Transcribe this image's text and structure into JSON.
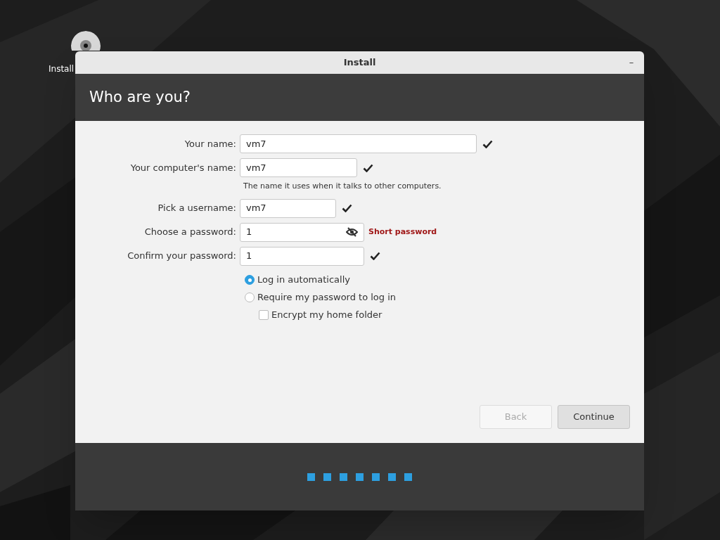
{
  "desktop": {
    "icons": [
      {
        "label": "Install"
      }
    ]
  },
  "window": {
    "title": "Install",
    "minimize": "–"
  },
  "header": {
    "title": "Who are you?"
  },
  "form": {
    "fields": [
      {
        "label": "Your name:",
        "value": "vm7",
        "kind": "text",
        "valid": true
      },
      {
        "label": "Your computer's name:",
        "value": "vm7",
        "kind": "text",
        "valid": true,
        "hint": "The name it uses when it talks to other computers."
      },
      {
        "label": "Pick a username:",
        "value": "vm7",
        "kind": "text",
        "valid": true
      },
      {
        "label": "Choose a password:",
        "value": "1",
        "kind": "password",
        "valid": false,
        "message": "Short password"
      },
      {
        "label": "Confirm your password:",
        "value": "1",
        "kind": "text",
        "valid": true
      }
    ],
    "login_options": [
      {
        "label": "Log in automatically",
        "kind": "radio",
        "selected": true
      },
      {
        "label": "Require my password to log in",
        "kind": "radio",
        "selected": false
      },
      {
        "label": "Encrypt my home folder",
        "kind": "checkbox",
        "checked": false
      }
    ]
  },
  "buttons": [
    {
      "label": "Back",
      "disabled": true
    },
    {
      "label": "Continue",
      "disabled": false
    }
  ],
  "progress": {
    "steps": [
      {
        "kind": "step"
      },
      {
        "kind": "step"
      },
      {
        "kind": "step"
      },
      {
        "kind": "step"
      },
      {
        "kind": "step"
      },
      {
        "kind": "step"
      },
      {
        "kind": "step"
      }
    ]
  }
}
